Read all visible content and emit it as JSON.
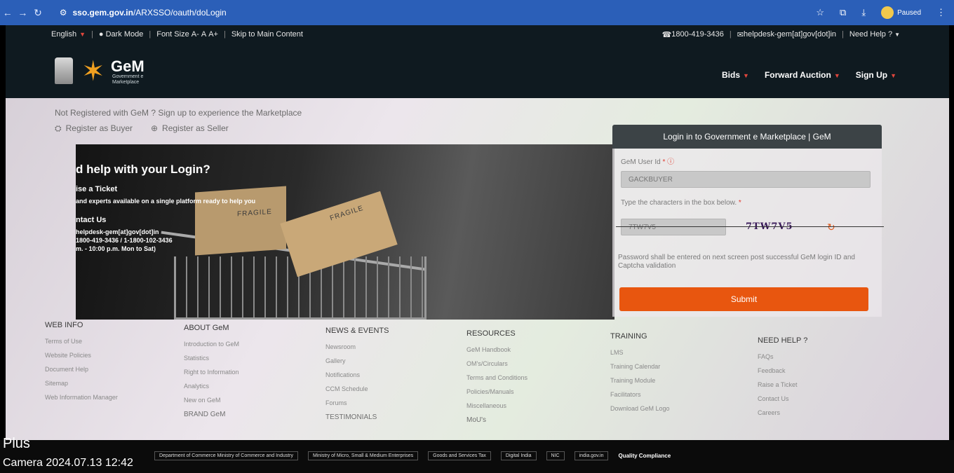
{
  "browser": {
    "url_domain": "sso.gem.gov.in",
    "url_path": "/ARXSSO/oauth/doLogin",
    "profile_status": "Paused"
  },
  "topbar": {
    "language": "English",
    "dark_mode": "Dark Mode",
    "font_size": "Font Size",
    "font_small": "A-",
    "font_normal": "A",
    "font_large": "A+",
    "skip": "Skip to Main Content",
    "phone": "1800-419-3436",
    "email": "helpdesk-gem[at]gov[dot]in",
    "need_help": "Need Help ?"
  },
  "header": {
    "logo_title": "GeM",
    "logo_sub": "Government e Marketplace",
    "nav": [
      "Bids",
      "Forward Auction",
      "Sign Up"
    ]
  },
  "register": {
    "prompt": "Not Registered with GeM ? Sign up to experience the Marketplace",
    "buyer": "Register as Buyer",
    "seller": "Register as Seller"
  },
  "banner": {
    "heading": "d help with your Login?",
    "ticket_title": "ise a Ticket",
    "ticket_line": "and experts available on a single platform ready to help you",
    "contact_title": "ntact Us",
    "contact_email": "helpdesk-gem[at]gov[dot]in",
    "contact_phone": "1800-419-3436 / 1-1800-102-3436",
    "contact_hours": "m. - 10:00 p.m. Mon to Sat)",
    "fragile": "FRAGILE"
  },
  "login": {
    "title": "Login in to Government e Marketplace | GeM",
    "user_label": "GeM User Id",
    "user_value": "GACKBUYER",
    "captcha_label": "Type the characters in the box below.",
    "captcha_value": "7TW7V5",
    "captcha_text": "7TW7V5",
    "note": "Password shall be entered on next screen post successful GeM login ID and Captcha validation",
    "submit": "Submit"
  },
  "footer": {
    "web_info": {
      "title": "WEB INFO",
      "items": [
        "Terms of Use",
        "Website Policies",
        "Document Help",
        "Sitemap",
        "Web Information Manager"
      ]
    },
    "about": {
      "title": "ABOUT GeM",
      "items": [
        "Introduction to GeM",
        "Statistics",
        "Right to Information",
        "Analytics",
        "New on GeM"
      ],
      "extra": "BRAND GeM"
    },
    "news": {
      "title": "NEWS & EVENTS",
      "items": [
        "Newsroom",
        "Gallery",
        "Notifications",
        "CCM Schedule",
        "Forums"
      ],
      "extra": "TESTIMONIALS"
    },
    "resources": {
      "title": "RESOURCES",
      "items": [
        "GeM Handbook",
        "OM's/Circulars",
        "Terms and Conditions",
        "Policies/Manuals",
        "Miscellaneous"
      ],
      "extra": "MoU's"
    },
    "training": {
      "title": "TRAINING",
      "items": [
        "LMS",
        "Training Calendar",
        "Training Module",
        "Facilitators",
        "Download GeM Logo"
      ]
    },
    "help": {
      "title": "NEED HELP ?",
      "items": [
        "FAQs",
        "Feedback",
        "Raise a Ticket",
        "Contact Us",
        "Careers"
      ]
    }
  },
  "bottom": {
    "plus": "Plus",
    "camera": "Camera  2024.07.13 12:42",
    "logos": [
      "Department of Commerce Ministry of Commerce and Industry",
      "Ministry of Micro, Small & Medium Enterprises",
      "Goods and Services Tax",
      "Digital India",
      "NIC",
      "india.gov.in"
    ],
    "quality": "Quality Compliance"
  }
}
